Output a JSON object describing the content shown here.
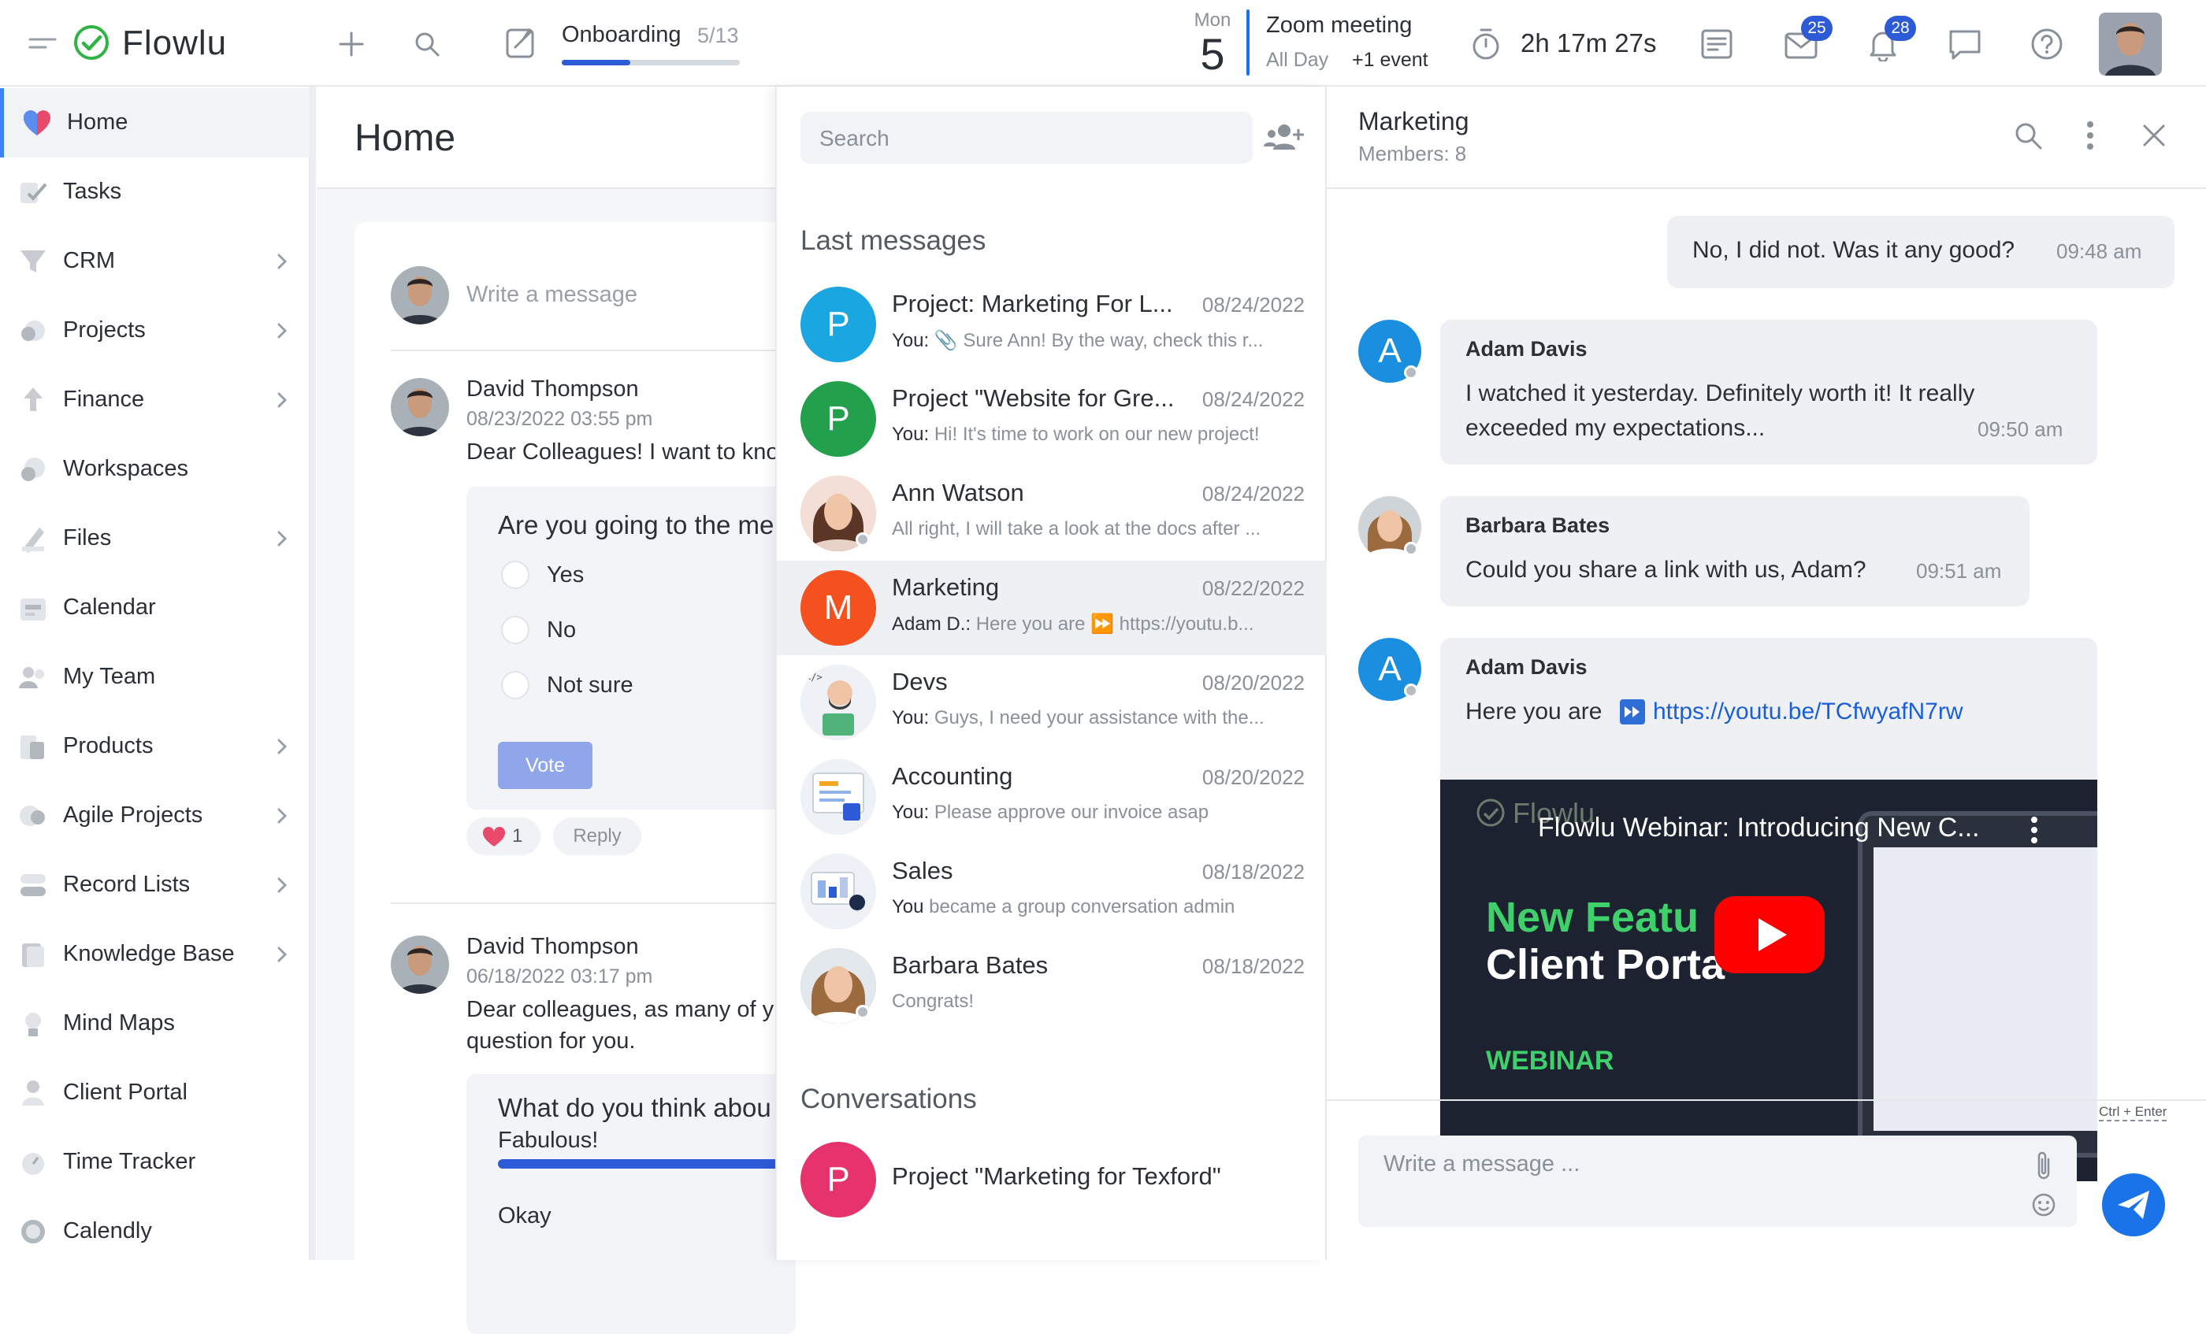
{
  "app": {
    "name": "Flowlu"
  },
  "topbar": {
    "onboarding_label": "Onboarding",
    "onboarding_progress": "5/13",
    "onboarding_fraction": 0.385,
    "date_day": "Mon",
    "date_num": "5",
    "event_title": "Zoom meeting",
    "event_allday": "All Day",
    "event_more": "+1 event",
    "timer": "2h 17m 27s",
    "mail_badge": "25",
    "notif_badge": "28"
  },
  "sidebar": {
    "items": [
      {
        "label": "Home",
        "chev": false
      },
      {
        "label": "Tasks",
        "chev": false
      },
      {
        "label": "CRM",
        "chev": true
      },
      {
        "label": "Projects",
        "chev": true
      },
      {
        "label": "Finance",
        "chev": true
      },
      {
        "label": "Workspaces",
        "chev": false
      },
      {
        "label": "Files",
        "chev": true
      },
      {
        "label": "Calendar",
        "chev": false
      },
      {
        "label": "My Team",
        "chev": false
      },
      {
        "label": "Products",
        "chev": true
      },
      {
        "label": "Agile Projects",
        "chev": true
      },
      {
        "label": "Record Lists",
        "chev": true
      },
      {
        "label": "Knowledge Base",
        "chev": true
      },
      {
        "label": "Mind Maps",
        "chev": false
      },
      {
        "label": "Client Portal",
        "chev": false
      },
      {
        "label": "Time Tracker",
        "chev": false
      },
      {
        "label": "Calendly",
        "chev": false
      }
    ]
  },
  "home": {
    "title": "Home",
    "composer_placeholder": "Write a message",
    "post1": {
      "author": "David Thompson",
      "date": "08/23/2022 03:55 pm",
      "text": "Dear Colleagues! I want to kno",
      "poll_question": "Are you going to the me",
      "options": [
        "Yes",
        "No",
        "Not sure"
      ],
      "vote_label": "Vote",
      "likes": "1",
      "reply_label": "Reply"
    },
    "post2": {
      "author": "David Thompson",
      "date": "06/18/2022 03:17 pm",
      "text_line1": "Dear colleagues, as many of y",
      "text_line2": "question for you.",
      "poll_question": "What do you think abou",
      "option1": "Fabulous!",
      "option2": "Okay"
    }
  },
  "messages": {
    "search_placeholder": "Search",
    "last_heading": "Last messages",
    "items": [
      {
        "title": "Project: Marketing For L...",
        "date": "08/24/2022",
        "prefix": "You:",
        "text": "📎 Sure Ann! By the way, check this r...",
        "letter": "P",
        "color": "#1aa6e0"
      },
      {
        "title": "Project \"Website for Gre...",
        "date": "08/24/2022",
        "prefix": "You:",
        "text": "Hi! It's time to work on our new project!",
        "letter": "P",
        "color": "#22a04b"
      },
      {
        "title": "Ann Watson",
        "date": "08/24/2022",
        "prefix": "",
        "text": "All right, I will take a look at the docs after ...",
        "letter": "",
        "color": "#e9b6a0"
      },
      {
        "title": "Marketing",
        "date": "08/22/2022",
        "prefix": "Adam D.:",
        "text": "Here you are ⏩ https://youtu.b...",
        "letter": "M",
        "color": "#f4511e"
      },
      {
        "title": "Devs",
        "date": "08/20/2022",
        "prefix": "You:",
        "text": "Guys, I need your assistance with the...",
        "letter": "",
        "color": "#e8eef5"
      },
      {
        "title": "Accounting",
        "date": "08/20/2022",
        "prefix": "You:",
        "text": "Please approve our invoice asap",
        "letter": "",
        "color": "#e8eef5"
      },
      {
        "title": "Sales",
        "date": "08/18/2022",
        "prefix": "You",
        "text": "became a group conversation admin",
        "letter": "",
        "color": "#e8eef5"
      },
      {
        "title": "Barbara Bates",
        "date": "08/18/2022",
        "prefix": "",
        "text": "Congrats!",
        "letter": "",
        "color": "#d8b48a"
      }
    ],
    "conv_heading": "Conversations",
    "conversation": {
      "title": "Project \"Marketing for Texford\"",
      "letter": "P",
      "color": "#e6336c"
    }
  },
  "chat": {
    "title": "Marketing",
    "members": "Members: 8",
    "m0_text": "No, I did not. Was it any good?",
    "m0_time": "09:48 am",
    "m1_name": "Adam Davis",
    "m1_line1": "I watched it yesterday. Definitely worth it! It really",
    "m1_line2": "exceeded my expectations...",
    "m1_time": "09:50 am",
    "m2_name": "Barbara Bates",
    "m2_text": "Could you share a link with us, Adam?",
    "m2_time": "09:51 am",
    "m3_name": "Adam Davis",
    "m3_text": "Here you are",
    "m3_link": "https://youtu.be/TCfwyafN7rw",
    "video_title": "Flowlu Webinar: Introducing New C...",
    "video_watermark": "Flowlu",
    "video_big1": "New Featu",
    "video_big2": "Client Porta",
    "video_tag": "WEBINAR",
    "avatar_letter": "A",
    "input_placeholder": "Write a message ...",
    "shortcut": "Ctrl + Enter"
  }
}
